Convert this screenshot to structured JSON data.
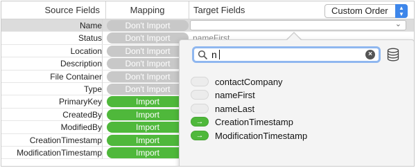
{
  "header": {
    "source_fields": "Source Fields",
    "mapping": "Mapping",
    "target_fields": "Target Fields",
    "order_select": "Custom Order"
  },
  "rows": [
    {
      "source": "Name",
      "mapping": "Don't Import",
      "target": ""
    },
    {
      "source": "Status",
      "mapping": "Don't Import",
      "target": "nameFirst"
    },
    {
      "source": "Location",
      "mapping": "Don't Import",
      "target": ""
    },
    {
      "source": "Description",
      "mapping": "Don't Import",
      "target": ""
    },
    {
      "source": "File Container",
      "mapping": "Don't Import",
      "target": ""
    },
    {
      "source": "Type",
      "mapping": "Don't Import",
      "target": ""
    },
    {
      "source": "PrimaryKey",
      "mapping": "Import",
      "target": ""
    },
    {
      "source": "CreatedBy",
      "mapping": "Import",
      "target": ""
    },
    {
      "source": "ModifiedBy",
      "mapping": "Import",
      "target": ""
    },
    {
      "source": "CreationTimestamp",
      "mapping": "Import",
      "target": ""
    },
    {
      "source": "ModificationTimestamp",
      "mapping": "Import",
      "target": ""
    }
  ],
  "popover": {
    "search_value": "n",
    "fields": [
      {
        "label": "contactCompany",
        "mapped": false
      },
      {
        "label": "nameFirst",
        "mapped": false
      },
      {
        "label": "nameLast",
        "mapped": false
      },
      {
        "label": "CreationTimestamp",
        "mapped": true
      },
      {
        "label": "ModificationTimestamp",
        "mapped": true
      }
    ]
  },
  "colors": {
    "import": "#4fb83b",
    "dont_import": "#c8c8c8",
    "accent": "#3d86ea",
    "focus_ring": "#8fb7ef"
  },
  "icons": {
    "stepper": "up-down-arrows-icon",
    "search": "magnifier-icon",
    "clear": "clear-x-icon",
    "database": "database-icon",
    "chevron": "chevron-down-icon",
    "mapped_arrow": "arrow-right-icon"
  }
}
